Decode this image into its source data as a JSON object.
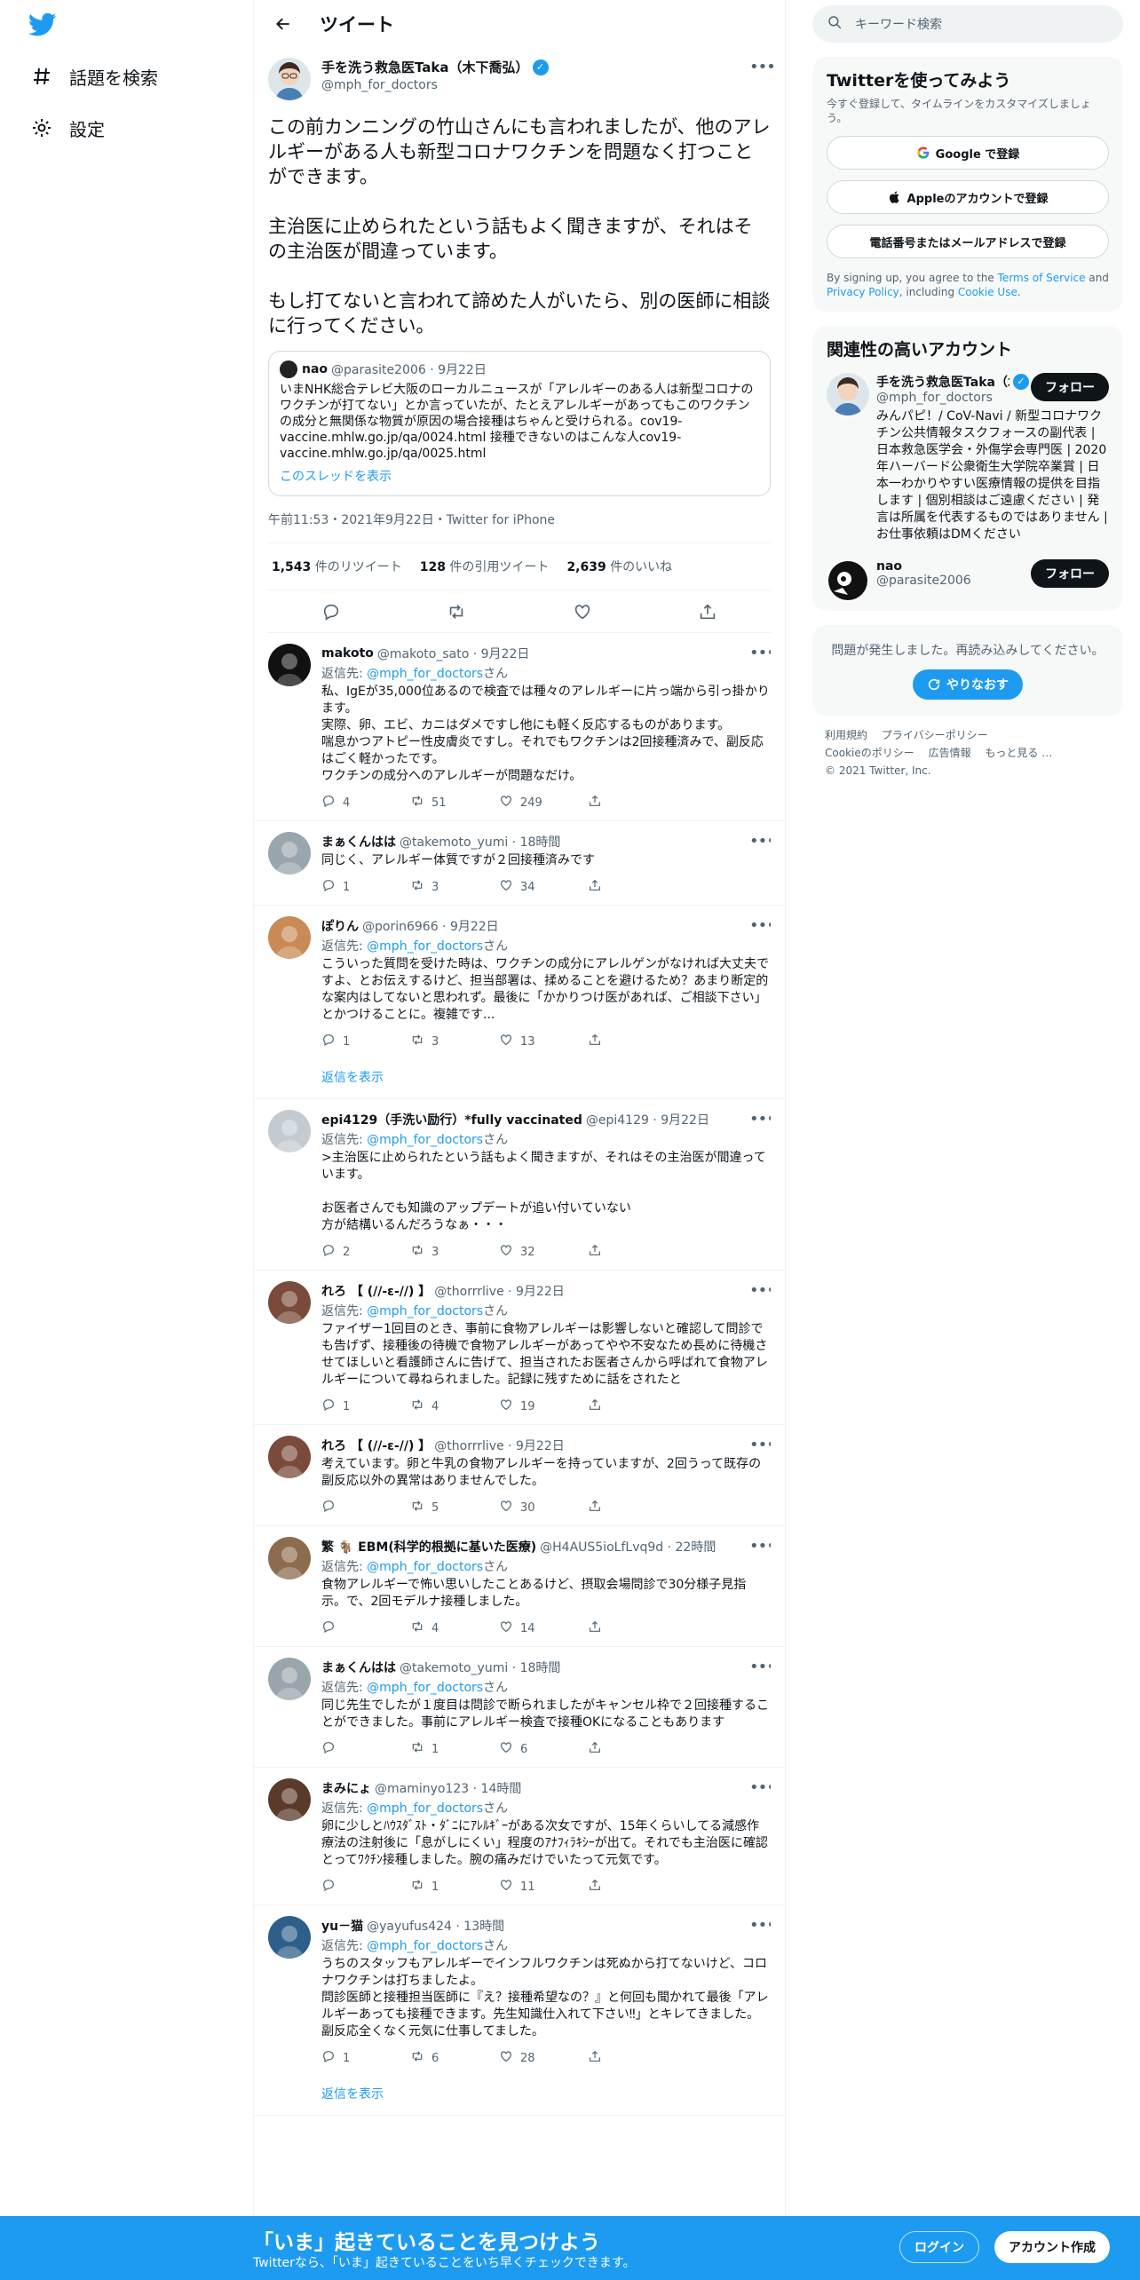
{
  "colors": {
    "accent": "#1d9bf0",
    "text": "#0f1419",
    "muted": "#536471",
    "like": "#f91880"
  },
  "nav": {
    "items": [
      {
        "label": "話題を検索",
        "icon": "hash-icon"
      },
      {
        "label": "設定",
        "icon": "gear-icon"
      }
    ]
  },
  "header": {
    "title": "ツイート"
  },
  "main_tweet": {
    "name": "手を洗う救急医Taka（木下喬弘）",
    "handle": "@mph_for_doctors",
    "text": "この前カンニングの竹山さんにも言われましたが、他のアレルギーがある人も新型コロナワクチンを問題なく打つことができます。\n\n主治医に止められたという話もよく聞きますが、それはその主治医が間違っています。\n\nもし打てないと言われて諦めた人がいたら、別の医師に相談に行ってください。",
    "quote": {
      "name": "nao",
      "meta": "@parasite2006 · 9月22日",
      "text": "いまNHK総合テレビ大阪のローカルニュースが「アレルギーのある人は新型コロナのワクチンが打てない」とか言っていたが、たとえアレルギーがあってもこのワクチンの成分と無関係な物質が原因の場合接種はちゃんと受けられる。cov19-vaccine.mhlw.go.jp/qa/0024.html 接種できないのはこんな人cov19-vaccine.mhlw.go.jp/qa/0025.html",
      "link": "このスレッドを表示"
    },
    "time": "午前11:53・2021年9月22日・Twitter for iPhone",
    "stats": {
      "retweets": "1,543",
      "retweets_label": " 件のリツイート",
      "quotes": "128",
      "quotes_label": " 件の引用ツイート",
      "likes": "2,639",
      "likes_label": " 件のいいね"
    }
  },
  "reply_to_label": "返信先: ",
  "reply_to_handle": "@mph_for_doctors",
  "reply_to_suffix": "さん",
  "show_replies_label": "返信を表示",
  "replies": [
    {
      "name": "makoto",
      "meta": "@makoto_sato · 9月22日",
      "replyto": true,
      "text": "私、IgEが35,000位あるので検査では種々のアレルギーに片っ端から引っ掛かります。\n実際、卵、エビ、カニはダメですし他にも軽く反応するものがあります。\n喘息かつアトピー性皮膚炎ですし。それでもワクチンは2回接種済みで、副反応はごく軽かったです。\nワクチンの成分へのアレルギーが問題なだけ。",
      "reply": "4",
      "retweet": "51",
      "like": "249"
    },
    {
      "name": "まぁくんはは",
      "meta": "@takemoto_yumi · 18時間",
      "replyto": false,
      "text": "同じく、アレルギー体質ですが２回接種済みです",
      "reply": "1",
      "retweet": "3",
      "like": "34"
    },
    {
      "name": "ぽりん",
      "meta": "@porin6966 · 9月22日",
      "replyto": true,
      "text": "こういった質問を受けた時は、ワクチンの成分にアレルゲンがなければ大丈夫ですよ、とお伝えするけど、担当部署は、揉めることを避けるため？あまり断定的な案内はしてないと思われず。最後に「かかりつけ医があれば、ご相談下さい」とかつけることに。複雑です...",
      "reply": "1",
      "retweet": "3",
      "like": "13"
    },
    {
      "name": "epi4129（手洗い励行）*fully vaccinated",
      "meta": "@epi4129 · 9月22日",
      "replyto": true,
      "text": ">主治医に止められたという話もよく聞きますが、それはその主治医が間違っています。\n\nお医者さんでも知識のアップデートが追い付いていない\n方が結構いるんだろうなぁ・・・",
      "reply": "2",
      "retweet": "3",
      "like": "32"
    },
    {
      "name": "れろ 【 (//-ε-//) 】",
      "meta": "@thorrrlive · 9月22日",
      "replyto": true,
      "text": "ファイザー1回目のとき、事前に食物アレルギーは影響しないと確認して問診でも告げず、接種後の待機で食物アレルギーがあってやや不安なため長めに待機させてほしいと看護師さんに告げて、担当されたお医者さんから呼ばれて食物アレルギーについて尋ねられました。記録に残すために話をされたと",
      "reply": "1",
      "retweet": "4",
      "like": "19"
    },
    {
      "name": "れろ 【 (//-ε-//) 】",
      "meta": "@thorrrlive · 9月22日",
      "replyto": false,
      "text": "考えています。卵と牛乳の食物アレルギーを持っていますが、2回うって既存の副反応以外の異常はありませんでした。",
      "reply": "",
      "retweet": "5",
      "like": "30"
    },
    {
      "name": "繁 🐐 EBM(科学的根拠に基いた医療)",
      "meta": "@H4AUS5ioLfLvq9d · 22時間",
      "replyto": true,
      "text": "食物アレルギーで怖い思いしたことあるけど、摂取会場問診で30分様子見指示。で、2回モデルナ接種しました。",
      "reply": "",
      "retweet": "4",
      "like": "14"
    },
    {
      "name": "まぁくんはは",
      "meta": "@takemoto_yumi · 18時間",
      "replyto": true,
      "text": "同じ先生でしたが１度目は問診で断られましたがキャンセル枠で２回接種することができました。事前にアレルギー検査で接種OKになることもあります",
      "reply": "",
      "retweet": "1",
      "like": "6"
    },
    {
      "name": "まみにょ",
      "meta": "@maminyo123 · 14時間",
      "replyto": true,
      "text": "卵に少しとﾊｳｽﾀﾞｽﾄ・ﾀﾞﾆにｱﾚﾙｷﾞｰがある次女ですが、15年くらいしてる減感作療法の注射後に「息がしにくい」程度のｱﾅﾌｨﾗｷｼｰが出て。それでも主治医に確認とってﾜｸﾁﾝ接種しました。腕の痛みだけでいたって元気です。",
      "reply": "",
      "retweet": "1",
      "like": "11"
    },
    {
      "name": "yu－猫",
      "meta": "@yayufus424 · 13時間",
      "replyto": true,
      "text": "うちのスタッフもアレルギーでインフルワクチンは死ぬから打てないけど、コロナワクチンは打ちましたよ。\n問診医師と接種担当医師に『え？接種希望なの？』と何回も聞かれて最後「アレルギーあっても接種できます。先生知識仕入れて下さい‼」とキレてきました。\n副反応全くなく元気に仕事してました。",
      "reply": "1",
      "retweet": "6",
      "like": "28"
    }
  ],
  "search": {
    "placeholder": "キーワード検索"
  },
  "signup_card": {
    "title": "Twitterを使ってみよう",
    "subtitle": "今すぐ登録して、タイムラインをカスタマイズしましょう。",
    "google": "Google で登録",
    "apple": "Appleのアカウントで登録",
    "phone": "電話番号またはメールアドレスで登録",
    "terms_prefix": "By signing up, you agree to the ",
    "terms_tos": "Terms of Service",
    "terms_and": " and ",
    "terms_privacy": "Privacy Policy",
    "terms_including": ", including ",
    "terms_cookie": "Cookie Use",
    "terms_end": "."
  },
  "related": {
    "title": "関連性の高いアカウント",
    "follow_label": "フォロー",
    "accounts": [
      {
        "name": "手を洗う救急医Taka（木下喬弘）",
        "handle": "@mph_for_doctors",
        "bio": "みんパピ！/ CoV-Navi / 新型コロナワクチン公共情報タスクフォースの副代表 | 日本救急医学会・外傷学会専門医 | 2020年ハーバード公衆衛生大学院卒業賞 | 日本一わかりやすい医療情報の提供を目指します | 個別相談はご遠慮ください | 発言は所属を代表するものではありません | お仕事依頼はDMください"
      },
      {
        "name": "nao",
        "handle": "@parasite2006",
        "bio": ""
      }
    ]
  },
  "error_card": {
    "message": "問題が発生しました。再読み込みしてください。",
    "retry": "やりなおす"
  },
  "footer": {
    "links": [
      "利用規約",
      "プライバシーポリシー",
      "Cookieのポリシー",
      "広告情報",
      "もっと見る …"
    ],
    "copyright": "© 2021 Twitter, Inc."
  },
  "bottom_bar": {
    "title": "「いま」起きていることを見つけよう",
    "subtitle": "Twitterなら、「いま」起きていることをいち早くチェックできます。",
    "login": "ログイン",
    "signup": "アカウント作成"
  }
}
